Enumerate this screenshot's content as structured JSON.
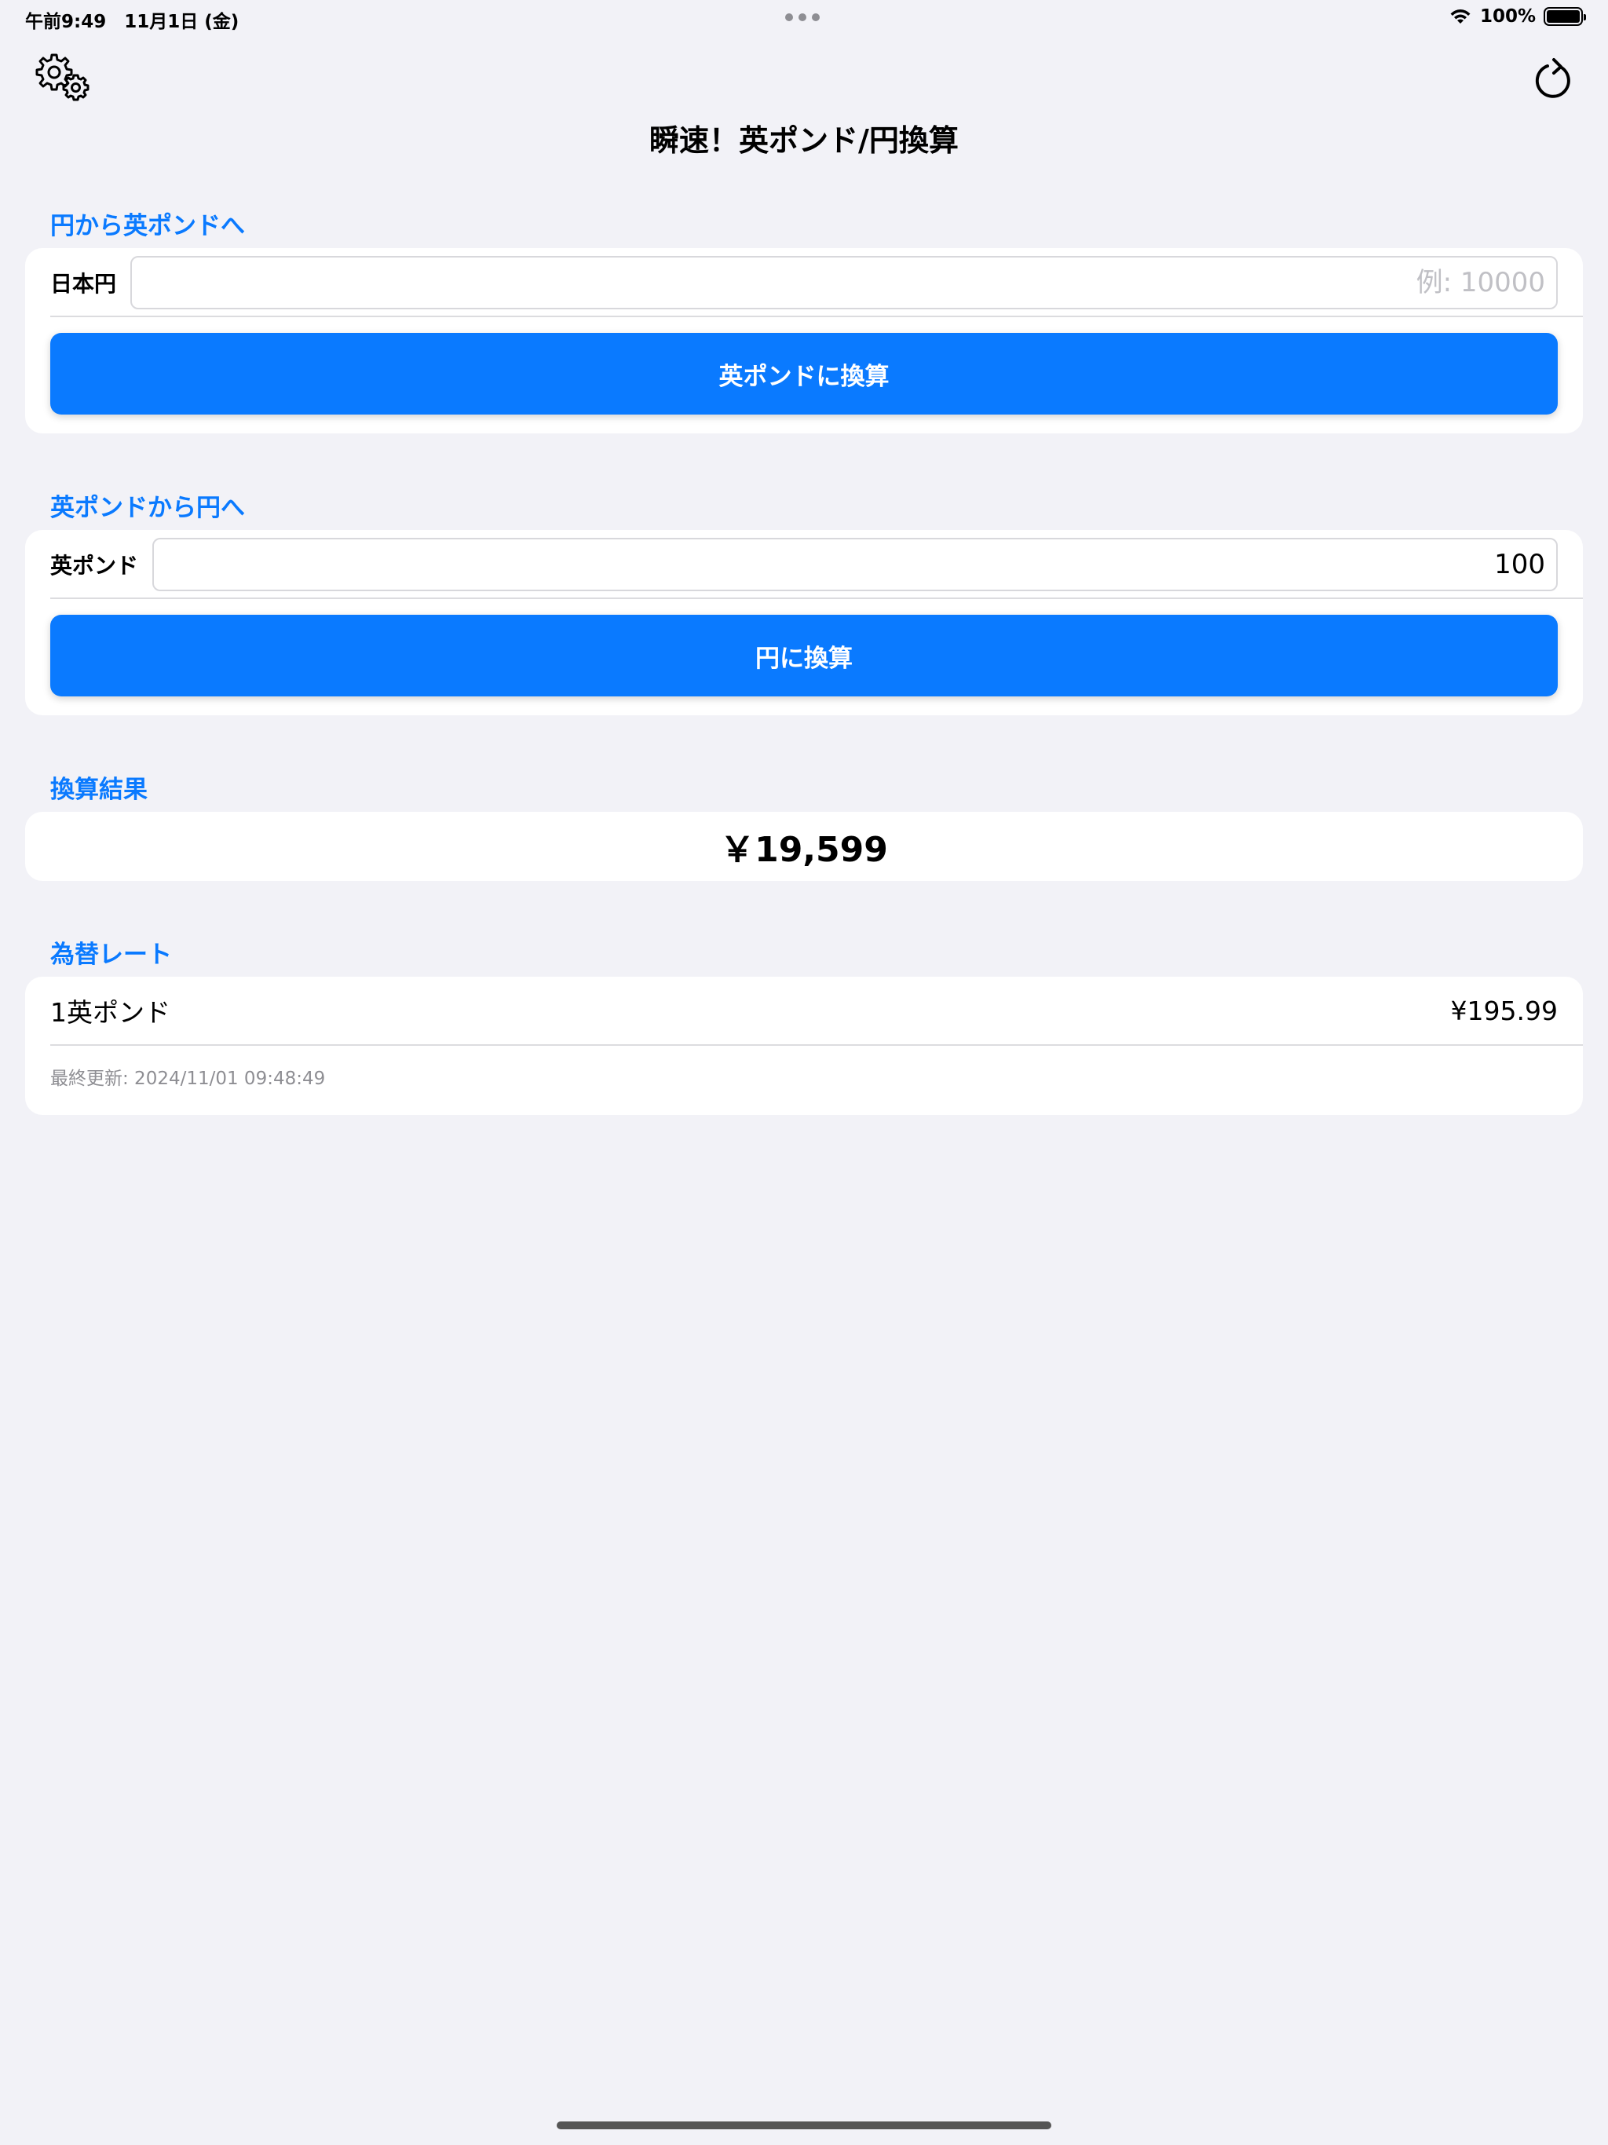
{
  "status_bar": {
    "time_date": "午前9:49　11月1日 (金)",
    "battery": "100%"
  },
  "nav": {
    "title": "瞬速！英ポンド/円換算",
    "settings_icon": "gears-icon",
    "refresh_icon": "refresh-icon"
  },
  "yen_to_gbp": {
    "header": "円から英ポンドへ",
    "label": "日本円",
    "value": "",
    "placeholder": "例: 10000",
    "button": "英ポンドに換算"
  },
  "gbp_to_yen": {
    "header": "英ポンドから円へ",
    "label": "英ポンド",
    "value": "100",
    "placeholder": "",
    "button": "円に換算"
  },
  "result": {
    "header": "換算結果",
    "value": "￥19,599"
  },
  "rate": {
    "header": "為替レート",
    "unit_label": "1英ポンド",
    "unit_value": "¥195.99",
    "last_updated": "最終更新: 2024/11/01 09:48:49"
  },
  "colors": {
    "accent": "#0a7aff",
    "background": "#f2f2f7",
    "card": "#ffffff"
  }
}
